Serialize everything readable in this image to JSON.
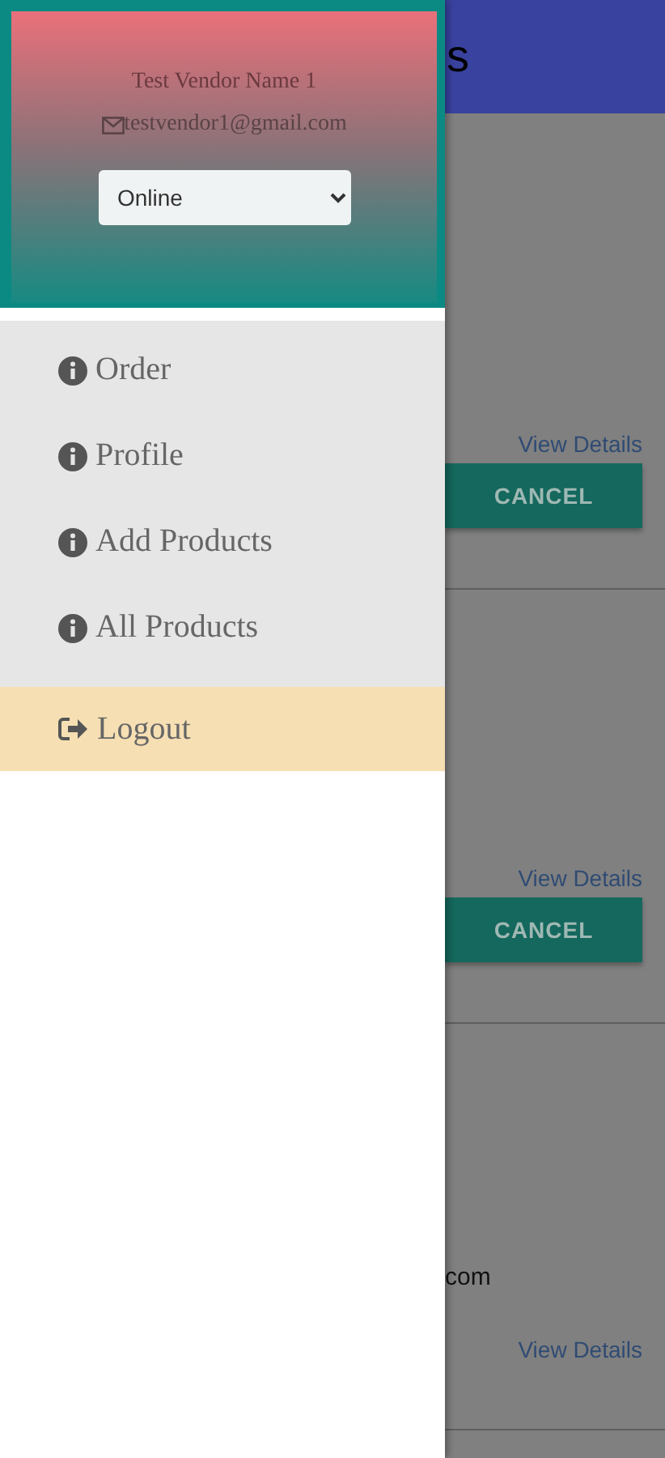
{
  "drawer": {
    "vendor_name": "Test Vendor Name 1",
    "email": "testvendor1@gmail.com",
    "status": "Online",
    "menu": [
      {
        "label": "Order",
        "kind": "nav"
      },
      {
        "label": "Profile",
        "kind": "nav"
      },
      {
        "label": "Add Products",
        "kind": "nav"
      },
      {
        "label": "All Products",
        "kind": "nav"
      },
      {
        "label": "Logout",
        "kind": "logout"
      }
    ]
  },
  "background": {
    "header_title": "s",
    "orders": [
      {
        "details_link": "View Details",
        "cancel_button": "CANCEL"
      },
      {
        "details_link": "View Details",
        "cancel_button": "CANCEL"
      },
      {
        "line": "com",
        "details_link": "View Details"
      }
    ]
  }
}
